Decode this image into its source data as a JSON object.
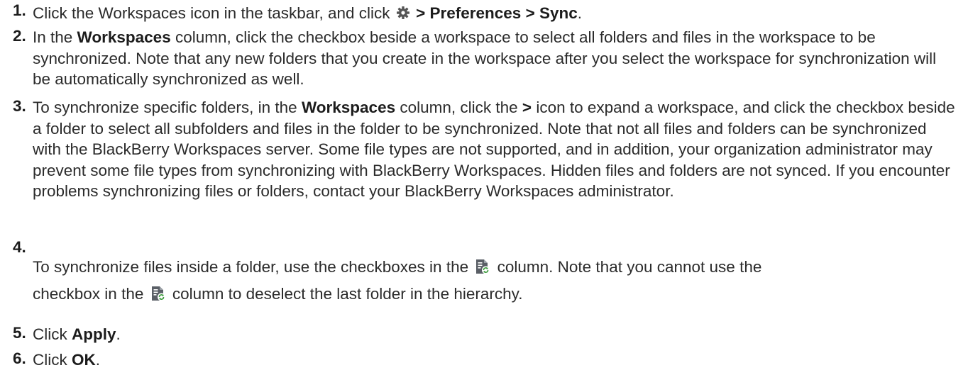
{
  "steps": [
    {
      "num": "1.",
      "t1": "Click the Workspaces icon in the taskbar, and click",
      "icon": "gear-icon",
      "t2": "> Preferences > Sync",
      "t3": "."
    },
    {
      "num": "2.",
      "t1": "In the ",
      "b1": "Workspaces",
      "t2": " column, click the checkbox beside a workspace to select all folders and files in the workspace to be synchronized. Note that any new folders that you create in the workspace after you select the workspace for synchronization will be automatically synchronized as well."
    },
    {
      "num": "3.",
      "t1": "To synchronize specific folders, in the ",
      "b1": "Workspaces",
      "t2": " column, click the ",
      "b2": ">",
      "t3": " icon to expand a workspace, and click the checkbox beside a folder to select all subfolders and files in the folder to be synchronized. Note that not all files and folders can be synchronized with the BlackBerry Workspaces server. Some file types are not supported, and in addition, your organization administrator may prevent some file types from synchronizing with BlackBerry Workspaces. Hidden files and folders are not synced. If you encounter problems synchronizing files or folders, contact your BlackBerry Workspaces administrator."
    },
    {
      "num": "4.",
      "line1a": "To synchronize files inside a folder, use the checkboxes in the ",
      "line1b": " column. Note that you cannot use the",
      "line2a": "checkbox in the ",
      "line2b": " column to deselect the last folder in the hierarchy.",
      "icon": "sync-file-icon"
    },
    {
      "num": "5.",
      "t1": "Click ",
      "b1": "Apply",
      "t2": "."
    },
    {
      "num": "6.",
      "t1": "Click ",
      "b1": "OK",
      "t2": "."
    }
  ]
}
